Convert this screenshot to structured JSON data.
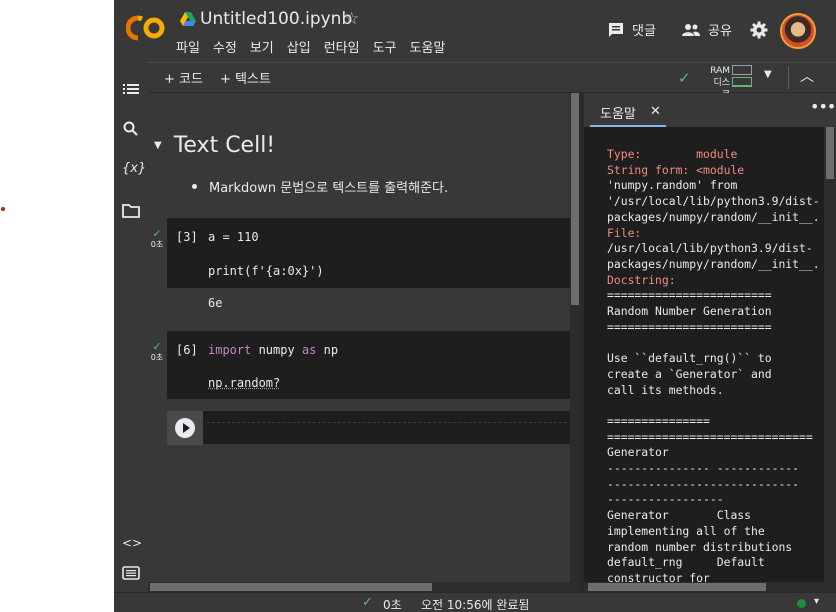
{
  "header": {
    "doc_title": "Untitled100.ipynb",
    "menu": [
      "파일",
      "수정",
      "보기",
      "삽입",
      "런타임",
      "도구",
      "도움말"
    ],
    "comment_label": "댓글",
    "share_label": "공유",
    "colors": {
      "logo_primary": "#f9ab00",
      "logo_secondary": "#e37400"
    }
  },
  "toolbar": {
    "add_code": "+ 코드",
    "add_text": "+ 텍스트",
    "ram_label": "RAM",
    "disk_label": "디스크"
  },
  "rail": {
    "icons": [
      "toc-icon",
      "search-icon",
      "variables-icon",
      "folder-icon",
      "code-snippets-icon",
      "terminal-icon"
    ],
    "variables_glyph": "{x}",
    "code_glyph": "<>"
  },
  "notebook": {
    "text_cell": {
      "title": "Text Cell!",
      "bullet": "Markdown 문법으로 텍스트를 출력해준다."
    },
    "cells": [
      {
        "exec_count": "[3]",
        "status_time": "0초",
        "lines": [
          "a = 110",
          "print(f'{a:0x}')"
        ],
        "output": "6e"
      },
      {
        "exec_count": "[6]",
        "status_time": "0초",
        "line1_kw1": "import",
        "line1_mid": " numpy ",
        "line1_kw2": "as",
        "line1_end": " np",
        "line2": "np.random?"
      }
    ]
  },
  "help_panel": {
    "tab_label": "도움말",
    "lines": [
      {
        "t": "Type:        module",
        "red": true
      },
      {
        "t": "String form: <module",
        "red": true
      },
      {
        "t": "'numpy.random' from",
        "red": false
      },
      {
        "t": "'/usr/local/lib/python3.9/dist-",
        "red": false
      },
      {
        "t": "packages/numpy/random/__init__.",
        "red": false
      },
      {
        "t": "File:",
        "red": true
      },
      {
        "t": "/usr/local/lib/python3.9/dist-",
        "red": false
      },
      {
        "t": "packages/numpy/random/__init__.",
        "red": false
      },
      {
        "t": "Docstring:",
        "red": true
      },
      {
        "t": "========================",
        "red": false
      },
      {
        "t": "Random Number Generation",
        "red": false
      },
      {
        "t": "========================",
        "red": false
      },
      {
        "t": "",
        "red": false
      },
      {
        "t": "Use ``default_rng()`` to",
        "red": false
      },
      {
        "t": "create a `Generator` and",
        "red": false
      },
      {
        "t": "call its methods.",
        "red": false
      },
      {
        "t": "",
        "red": false
      },
      {
        "t": "===============",
        "red": false
      },
      {
        "t": "==============================",
        "red": false
      },
      {
        "t": "Generator",
        "red": false
      },
      {
        "t": "--------------- ------------",
        "red": false
      },
      {
        "t": "----------------------------",
        "red": false
      },
      {
        "t": "-----------------",
        "red": false
      },
      {
        "t": "Generator       Class",
        "red": false
      },
      {
        "t": "implementing all of the",
        "red": false
      },
      {
        "t": "random number distributions",
        "red": false
      },
      {
        "t": "default_rng     Default",
        "red": false
      },
      {
        "t": "constructor for",
        "red": false
      }
    ]
  },
  "statusbar": {
    "time": "0초",
    "done": "오전 10:56에 완료됨"
  }
}
